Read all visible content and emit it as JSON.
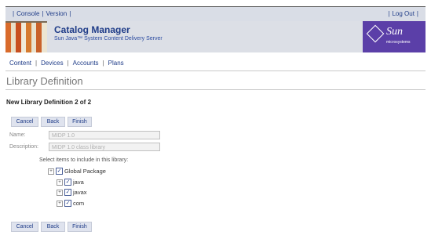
{
  "topbar": {
    "console": "Console",
    "version": "Version",
    "logout": "Log Out"
  },
  "banner": {
    "title": "Catalog Manager",
    "subtitle": "Sun Java™ System Content Delivery Server",
    "logo_word": "Sun",
    "logo_tag": "microsystems"
  },
  "nav": {
    "items": [
      {
        "label": "Content"
      },
      {
        "label": "Devices"
      },
      {
        "label": "Accounts"
      },
      {
        "label": "Plans"
      }
    ]
  },
  "page": {
    "title": "Library Definition",
    "step_title": "New Library Definition 2 of 2"
  },
  "buttons": {
    "cancel": "Cancel",
    "back": "Back",
    "finish": "Finish"
  },
  "form": {
    "name_label": "Name:",
    "name_value": "MIDP 1.0",
    "description_label": "Description:",
    "description_value": "MIDP 1.0 class library",
    "instructions": "Select items to include in this library:"
  },
  "tree": {
    "root": {
      "label": "Global Package",
      "toggle": "+",
      "checked": true
    },
    "children": [
      {
        "label": "java",
        "toggle": "+",
        "checked": true
      },
      {
        "label": "javax",
        "toggle": "+",
        "checked": true
      },
      {
        "label": "com",
        "toggle": "+",
        "checked": true
      }
    ],
    "check_glyph": "✓"
  },
  "colors": {
    "link": "#1f3c88",
    "banner_bg": "#dcdfe6",
    "logo_bg": "#5b3fa8",
    "button_bg": "#dfe3ee"
  }
}
